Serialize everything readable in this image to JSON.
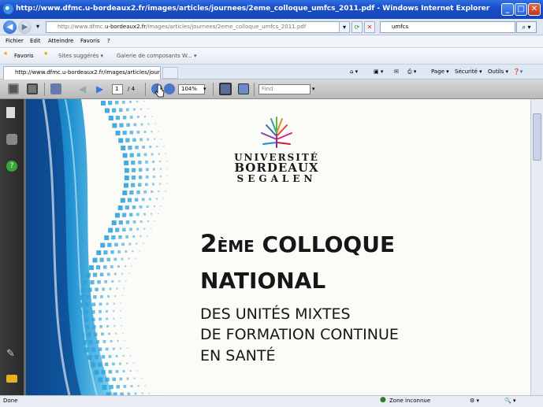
{
  "window": {
    "title": "http://www.dfmc.u-bordeaux2.fr/images/articles/journees/2eme_colloque_umfcs_2011.pdf - Windows Internet Explorer",
    "minimize": "_",
    "maximize": "□",
    "close": "✕"
  },
  "address": {
    "prefix": "http://www.dfmc.",
    "domain": "u-bordeaux2.fr",
    "suffix": "/images/articles/journees/2eme_colloque_umfcs_2011.pdf",
    "search_value": "umfcs"
  },
  "menu": {
    "items": [
      "Fichier",
      "Edit",
      "Atteindre",
      "Favoris",
      "?"
    ]
  },
  "favorites": {
    "favoris_label": "Favoris",
    "sites_label": "Sites suggérés ▾",
    "gallery_label": "Galerie de composants W... ▾"
  },
  "tab": {
    "label": "http://www.dfmc.u-bordeaux2.fr/images/articles/jour..."
  },
  "command_bar": {
    "page": "Page ▾",
    "security": "Sécurité ▾",
    "tools": "Outils ▾"
  },
  "pdf_toolbar": {
    "current_page": "1",
    "total_pages": "/ 4",
    "zoom": "104%",
    "find_placeholder": "Find"
  },
  "document": {
    "university_line1": "UNIVERSITÉ",
    "university_line2": "BORDEAUX",
    "university_line3": "SEGALEN",
    "headline1_big": "2",
    "headline1_small": "ÈME",
    "headline1_rest": " COLLOQUE",
    "headline2": "NATIONAL",
    "sub1": "DES UNITÉS MIXTES",
    "sub2": "DE FORMATION CONTINUE",
    "sub3": "EN SANTÉ"
  },
  "status": {
    "left": "Done",
    "zone": "Zone inconnue"
  },
  "colors": {
    "titlebar": "#1a4fc9",
    "page_bg": "#fbfbf8",
    "pattern_blue": "#1e8fd0"
  }
}
